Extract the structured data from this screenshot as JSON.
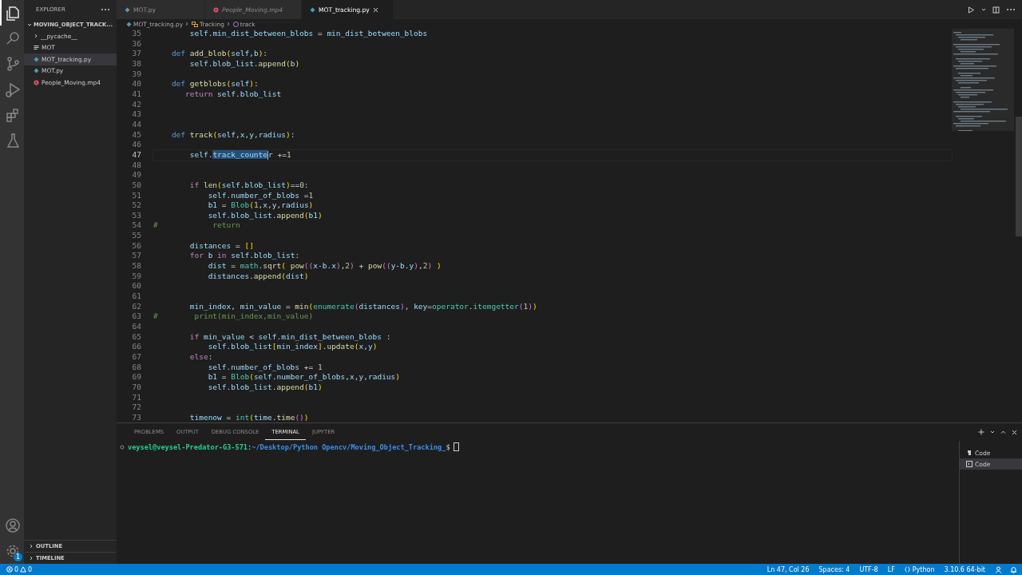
{
  "activity_bar": {
    "top": [
      {
        "kind": "explorer",
        "selected": true
      },
      {
        "kind": "search",
        "selected": false
      },
      {
        "kind": "source-control",
        "selected": false
      },
      {
        "kind": "run",
        "selected": false
      },
      {
        "kind": "extensions",
        "selected": false
      },
      {
        "kind": "testing",
        "selected": false
      }
    ],
    "bottom": [
      {
        "kind": "account"
      },
      {
        "kind": "settings",
        "badge": "1"
      }
    ]
  },
  "sidebar": {
    "title": "EXPLORER",
    "tree": {
      "label": "MOVING_OBJECT_TRACK...",
      "expanded": true,
      "children": [
        {
          "label": "__pycache__",
          "kind": "folder",
          "expanded": false,
          "selected": false
        },
        {
          "label": "MOT",
          "kind": "text",
          "selected": false
        },
        {
          "label": "MOT_tracking.py",
          "kind": "python",
          "selected": true
        },
        {
          "label": "MOT.py",
          "kind": "python",
          "selected": false
        },
        {
          "label": "People_Moving.mp4",
          "kind": "video",
          "selected": false
        }
      ]
    },
    "sections": [
      {
        "label": "OUTLINE",
        "expanded": false
      },
      {
        "label": "TIMELINE",
        "expanded": false
      }
    ]
  },
  "tabs": [
    {
      "label": "MOT.py",
      "kind": "python",
      "preview": false,
      "selected": false
    },
    {
      "label": "People_Moving.mp4",
      "kind": "video",
      "preview": true,
      "selected": false
    },
    {
      "label": "MOT_tracking.py",
      "kind": "python",
      "preview": false,
      "selected": true
    }
  ],
  "breadcrumbs": [
    {
      "label": "MOT_tracking.py",
      "kind": "file"
    },
    {
      "label": "Tracking",
      "kind": "class"
    },
    {
      "label": "track",
      "kind": "method"
    }
  ],
  "editor": {
    "lines": [
      {
        "n": "35",
        "current": false,
        "tokens": [
          {
            "kind": "var",
            "text": "        self"
          },
          {
            "kind": "p",
            "text": "."
          },
          {
            "kind": "var",
            "text": "min_dist_between_blobs"
          },
          {
            "kind": "p",
            "text": " = "
          },
          {
            "kind": "var",
            "text": "min_dist_between_blobs"
          }
        ]
      },
      {
        "n": "36",
        "current": false
      },
      {
        "n": "37",
        "current": false,
        "tokens": [
          {
            "kind": "kw",
            "text": "    def "
          },
          {
            "kind": "fn",
            "text": "add_blob"
          },
          {
            "kind": "br",
            "text": "("
          },
          {
            "kind": "var",
            "text": "self"
          },
          {
            "kind": "p",
            "text": ","
          },
          {
            "kind": "var",
            "text": "b"
          },
          {
            "kind": "br",
            "text": ")"
          },
          {
            "kind": "p",
            "text": ":"
          }
        ]
      },
      {
        "n": "38",
        "current": false,
        "tokens": [
          {
            "kind": "var",
            "text": "        self"
          },
          {
            "kind": "p",
            "text": "."
          },
          {
            "kind": "var",
            "text": "blob_list"
          },
          {
            "kind": "p",
            "text": "."
          },
          {
            "kind": "fn",
            "text": "append"
          },
          {
            "kind": "br",
            "text": "("
          },
          {
            "kind": "var",
            "text": "b"
          },
          {
            "kind": "br",
            "text": ")"
          }
        ]
      },
      {
        "n": "39",
        "current": false
      },
      {
        "n": "40",
        "current": false,
        "tokens": [
          {
            "kind": "kw",
            "text": "    def "
          },
          {
            "kind": "fn",
            "text": "getblobs"
          },
          {
            "kind": "br",
            "text": "("
          },
          {
            "kind": "var",
            "text": "self"
          },
          {
            "kind": "br",
            "text": ")"
          },
          {
            "kind": "p",
            "text": ":"
          }
        ]
      },
      {
        "n": "41",
        "current": false,
        "tokens": [
          {
            "kind": "ctl",
            "text": "       return "
          },
          {
            "kind": "var",
            "text": "self"
          },
          {
            "kind": "p",
            "text": "."
          },
          {
            "kind": "var",
            "text": "blob_list"
          }
        ]
      },
      {
        "n": "42",
        "current": false
      },
      {
        "n": "43",
        "current": false
      },
      {
        "n": "44",
        "current": false
      },
      {
        "n": "45",
        "current": false,
        "tokens": [
          {
            "kind": "kw",
            "text": "    def "
          },
          {
            "kind": "fn",
            "text": "track"
          },
          {
            "kind": "br",
            "text": "("
          },
          {
            "kind": "var",
            "text": "self"
          },
          {
            "kind": "p",
            "text": ","
          },
          {
            "kind": "var",
            "text": "x"
          },
          {
            "kind": "p",
            "text": ","
          },
          {
            "kind": "var",
            "text": "y"
          },
          {
            "kind": "p",
            "text": ","
          },
          {
            "kind": "var",
            "text": "radius"
          },
          {
            "kind": "br",
            "text": ")"
          },
          {
            "kind": "p",
            "text": ":"
          }
        ]
      },
      {
        "n": "46",
        "current": false
      },
      {
        "n": "47",
        "current": true,
        "tokens": [
          {
            "kind": "var",
            "text": "        self"
          },
          {
            "kind": "p",
            "text": "."
          },
          {
            "kind": "sel",
            "text": "track_counte"
          },
          {
            "kind": "var",
            "text": "r"
          },
          {
            "kind": "p",
            "text": " +="
          },
          {
            "kind": "num",
            "text": "1"
          }
        ]
      },
      {
        "n": "48",
        "current": false
      },
      {
        "n": "49",
        "current": false
      },
      {
        "n": "50",
        "current": false,
        "tokens": [
          {
            "kind": "ctl",
            "text": "        if "
          },
          {
            "kind": "fn",
            "text": "len"
          },
          {
            "kind": "br",
            "text": "("
          },
          {
            "kind": "var",
            "text": "self"
          },
          {
            "kind": "p",
            "text": "."
          },
          {
            "kind": "var",
            "text": "blob_list"
          },
          {
            "kind": "br",
            "text": ")"
          },
          {
            "kind": "p",
            "text": "=="
          },
          {
            "kind": "num",
            "text": "0"
          },
          {
            "kind": "p",
            "text": ":"
          }
        ]
      },
      {
        "n": "51",
        "current": false,
        "tokens": [
          {
            "kind": "var",
            "text": "            self"
          },
          {
            "kind": "p",
            "text": "."
          },
          {
            "kind": "var",
            "text": "number_of_blobs"
          },
          {
            "kind": "p",
            "text": " ="
          },
          {
            "kind": "num",
            "text": "1"
          }
        ]
      },
      {
        "n": "52",
        "current": false,
        "tokens": [
          {
            "kind": "var",
            "text": "            b1"
          },
          {
            "kind": "p",
            "text": " = "
          },
          {
            "kind": "cls",
            "text": "Blob"
          },
          {
            "kind": "br",
            "text": "("
          },
          {
            "kind": "num",
            "text": "1"
          },
          {
            "kind": "p",
            "text": ","
          },
          {
            "kind": "var",
            "text": "x"
          },
          {
            "kind": "p",
            "text": ","
          },
          {
            "kind": "var",
            "text": "y"
          },
          {
            "kind": "p",
            "text": ","
          },
          {
            "kind": "var",
            "text": "radius"
          },
          {
            "kind": "br",
            "text": ")"
          }
        ]
      },
      {
        "n": "53",
        "current": false,
        "tokens": [
          {
            "kind": "var",
            "text": "            self"
          },
          {
            "kind": "p",
            "text": "."
          },
          {
            "kind": "var",
            "text": "blob_list"
          },
          {
            "kind": "p",
            "text": "."
          },
          {
            "kind": "fn",
            "text": "append"
          },
          {
            "kind": "br",
            "text": "("
          },
          {
            "kind": "var",
            "text": "b1"
          },
          {
            "kind": "br",
            "text": ")"
          }
        ]
      },
      {
        "n": "54",
        "current": false,
        "tokens": [
          {
            "kind": "cm",
            "text": "#            return"
          }
        ]
      },
      {
        "n": "55",
        "current": false
      },
      {
        "n": "56",
        "current": false,
        "tokens": [
          {
            "kind": "var",
            "text": "        distances"
          },
          {
            "kind": "p",
            "text": " = "
          },
          {
            "kind": "br",
            "text": "[]"
          }
        ]
      },
      {
        "n": "57",
        "current": false,
        "tokens": [
          {
            "kind": "ctl",
            "text": "        for "
          },
          {
            "kind": "var",
            "text": "b"
          },
          {
            "kind": "ctl",
            "text": " in "
          },
          {
            "kind": "var",
            "text": "self"
          },
          {
            "kind": "p",
            "text": "."
          },
          {
            "kind": "var",
            "text": "blob_list"
          },
          {
            "kind": "p",
            "text": ":"
          }
        ]
      },
      {
        "n": "58",
        "current": false,
        "tokens": [
          {
            "kind": "var",
            "text": "            dist"
          },
          {
            "kind": "p",
            "text": " = "
          },
          {
            "kind": "cls",
            "text": "math"
          },
          {
            "kind": "p",
            "text": "."
          },
          {
            "kind": "fn",
            "text": "sqrt"
          },
          {
            "kind": "br",
            "text": "( "
          },
          {
            "kind": "fn",
            "text": "pow"
          },
          {
            "kind": "br2",
            "text": "(("
          },
          {
            "kind": "var",
            "text": "x-b.x"
          },
          {
            "kind": "br2",
            "text": ")"
          },
          {
            "kind": "p",
            "text": ","
          },
          {
            "kind": "num",
            "text": "2"
          },
          {
            "kind": "br2",
            "text": ")"
          },
          {
            "kind": "p",
            "text": " + "
          },
          {
            "kind": "fn",
            "text": "pow"
          },
          {
            "kind": "br2",
            "text": "(("
          },
          {
            "kind": "var",
            "text": "y-b.y"
          },
          {
            "kind": "br2",
            "text": ")"
          },
          {
            "kind": "p",
            "text": ","
          },
          {
            "kind": "num",
            "text": "2"
          },
          {
            "kind": "br2",
            "text": ")"
          },
          {
            "kind": "br",
            "text": " )"
          }
        ]
      },
      {
        "n": "59",
        "current": false,
        "tokens": [
          {
            "kind": "var",
            "text": "            distances"
          },
          {
            "kind": "p",
            "text": "."
          },
          {
            "kind": "fn",
            "text": "append"
          },
          {
            "kind": "br",
            "text": "("
          },
          {
            "kind": "var",
            "text": "dist"
          },
          {
            "kind": "br",
            "text": ")"
          }
        ]
      },
      {
        "n": "60",
        "current": false
      },
      {
        "n": "61",
        "current": false
      },
      {
        "n": "62",
        "current": false,
        "tokens": [
          {
            "kind": "var",
            "text": "        min_index"
          },
          {
            "kind": "p",
            "text": ", "
          },
          {
            "kind": "var",
            "text": "min_value"
          },
          {
            "kind": "p",
            "text": " = "
          },
          {
            "kind": "fn",
            "text": "min"
          },
          {
            "kind": "br",
            "text": "("
          },
          {
            "kind": "cls",
            "text": "enumerate"
          },
          {
            "kind": "br2",
            "text": "("
          },
          {
            "kind": "var",
            "text": "distances"
          },
          {
            "kind": "br2",
            "text": ")"
          },
          {
            "kind": "p",
            "text": ", "
          },
          {
            "kind": "var",
            "text": "key"
          },
          {
            "kind": "p",
            "text": "="
          },
          {
            "kind": "cls",
            "text": "operator"
          },
          {
            "kind": "p",
            "text": "."
          },
          {
            "kind": "cls",
            "text": "itemgetter"
          },
          {
            "kind": "br2",
            "text": "("
          },
          {
            "kind": "num",
            "text": "1"
          },
          {
            "kind": "br2",
            "text": ")"
          },
          {
            "kind": "br",
            "text": ")"
          }
        ]
      },
      {
        "n": "63",
        "current": false,
        "tokens": [
          {
            "kind": "cm",
            "text": "#        print(min_index,min_value)"
          }
        ]
      },
      {
        "n": "64",
        "current": false
      },
      {
        "n": "65",
        "current": false,
        "tokens": [
          {
            "kind": "ctl",
            "text": "        if "
          },
          {
            "kind": "var",
            "text": "min_value"
          },
          {
            "kind": "p",
            "text": " < "
          },
          {
            "kind": "var",
            "text": "self"
          },
          {
            "kind": "p",
            "text": "."
          },
          {
            "kind": "var",
            "text": "min_dist_between_blobs"
          },
          {
            "kind": "p",
            "text": " :"
          }
        ]
      },
      {
        "n": "66",
        "current": false,
        "tokens": [
          {
            "kind": "var",
            "text": "            self"
          },
          {
            "kind": "p",
            "text": "."
          },
          {
            "kind": "var",
            "text": "blob_list"
          },
          {
            "kind": "br",
            "text": "["
          },
          {
            "kind": "var",
            "text": "min_index"
          },
          {
            "kind": "br",
            "text": "]"
          },
          {
            "kind": "p",
            "text": "."
          },
          {
            "kind": "fn",
            "text": "update"
          },
          {
            "kind": "br",
            "text": "("
          },
          {
            "kind": "var",
            "text": "x"
          },
          {
            "kind": "p",
            "text": ","
          },
          {
            "kind": "var",
            "text": "y"
          },
          {
            "kind": "br",
            "text": ")"
          }
        ]
      },
      {
        "n": "67",
        "current": false,
        "tokens": [
          {
            "kind": "ctl",
            "text": "        else"
          },
          {
            "kind": "p",
            "text": ":"
          }
        ]
      },
      {
        "n": "68",
        "current": false,
        "tokens": [
          {
            "kind": "var",
            "text": "            self"
          },
          {
            "kind": "p",
            "text": "."
          },
          {
            "kind": "var",
            "text": "number_of_blobs"
          },
          {
            "kind": "p",
            "text": " += "
          },
          {
            "kind": "num",
            "text": "1"
          }
        ]
      },
      {
        "n": "69",
        "current": false,
        "tokens": [
          {
            "kind": "var",
            "text": "            b1"
          },
          {
            "kind": "p",
            "text": " = "
          },
          {
            "kind": "cls",
            "text": "Blob"
          },
          {
            "kind": "br",
            "text": "("
          },
          {
            "kind": "var",
            "text": "self"
          },
          {
            "kind": "p",
            "text": "."
          },
          {
            "kind": "var",
            "text": "number_of_blobs"
          },
          {
            "kind": "p",
            "text": ","
          },
          {
            "kind": "var",
            "text": "x"
          },
          {
            "kind": "p",
            "text": ","
          },
          {
            "kind": "var",
            "text": "y"
          },
          {
            "kind": "p",
            "text": ","
          },
          {
            "kind": "var",
            "text": "radius"
          },
          {
            "kind": "br",
            "text": ")"
          }
        ]
      },
      {
        "n": "70",
        "current": false,
        "tokens": [
          {
            "kind": "var",
            "text": "            self"
          },
          {
            "kind": "p",
            "text": "."
          },
          {
            "kind": "var",
            "text": "blob_list"
          },
          {
            "kind": "p",
            "text": "."
          },
          {
            "kind": "fn",
            "text": "append"
          },
          {
            "kind": "br",
            "text": "("
          },
          {
            "kind": "var",
            "text": "b1"
          },
          {
            "kind": "br",
            "text": ")"
          }
        ]
      },
      {
        "n": "71",
        "current": false
      },
      {
        "n": "72",
        "current": false
      },
      {
        "n": "73",
        "current": false,
        "tokens": [
          {
            "kind": "var",
            "text": "        timenow"
          },
          {
            "kind": "p",
            "text": " = "
          },
          {
            "kind": "cls",
            "text": "int"
          },
          {
            "kind": "br",
            "text": "("
          },
          {
            "kind": "var",
            "text": "time"
          },
          {
            "kind": "p",
            "text": "."
          },
          {
            "kind": "fn",
            "text": "time"
          },
          {
            "kind": "br2",
            "text": "()"
          },
          {
            "kind": "br",
            "text": ")"
          }
        ]
      }
    ]
  },
  "panel": {
    "tabs": [
      {
        "label": "PROBLEMS",
        "selected": false
      },
      {
        "label": "OUTPUT",
        "selected": false
      },
      {
        "label": "DEBUG CONSOLE",
        "selected": false
      },
      {
        "label": "TERMINAL",
        "selected": true
      },
      {
        "label": "JUPYTER",
        "selected": false
      }
    ],
    "prompt": {
      "user": "veysel@veysel-Predator-G3-571",
      "separator": ":",
      "path": "~/Desktop/Python Opencv/Moving_Object_Tracking_",
      "symbol": "$"
    },
    "terminals": [
      {
        "label": "Code",
        "kind": "python",
        "selected": false
      },
      {
        "label": "Code",
        "kind": "shell",
        "selected": true
      }
    ]
  },
  "status_bar": {
    "errors": "0",
    "warnings": "0",
    "right": [
      {
        "label": "Ln 47, Col 26",
        "kind": "text"
      },
      {
        "label": "Spaces: 4",
        "kind": "text"
      },
      {
        "label": "UTF-8",
        "kind": "text"
      },
      {
        "label": "LF",
        "kind": "text"
      },
      {
        "label": "Python",
        "kind": "language"
      },
      {
        "label": "3.10.6 64-bit",
        "kind": "text"
      }
    ]
  }
}
